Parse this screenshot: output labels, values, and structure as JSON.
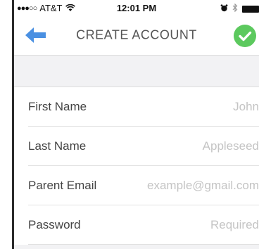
{
  "status_bar": {
    "signal": "●●●○○",
    "carrier": "AT&T",
    "time": "12:01 PM"
  },
  "nav": {
    "title": "CREATE ACCOUNT",
    "back_icon": "arrow-left-icon",
    "confirm_icon": "checkmark-circle-icon"
  },
  "colors": {
    "accent_blue": "#4a90e2",
    "confirm_green": "#5cc95e",
    "section_background": "#f2f2f4"
  },
  "form": {
    "fields": [
      {
        "label": "First Name",
        "placeholder": "John"
      },
      {
        "label": "Last Name",
        "placeholder": "Appleseed"
      },
      {
        "label": "Parent Email",
        "placeholder": "example@gmail.com"
      },
      {
        "label": "Password",
        "placeholder": "Required"
      }
    ]
  }
}
